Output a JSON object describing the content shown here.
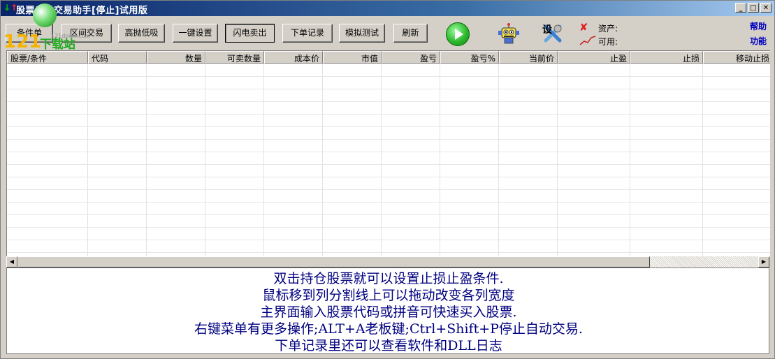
{
  "window": {
    "title": "股票自动交易助手[停止]试用版",
    "title_arrows": {
      "up": "↑",
      "down": "↓"
    },
    "controls": {
      "minimize": "_",
      "maximize": "□",
      "close": "✕"
    }
  },
  "logo": {
    "number": "121",
    "text": "下载站",
    "url": "121down.com"
  },
  "toolbar": {
    "buttons": [
      "条件单",
      "区间交易",
      "高抛低吸",
      "一键设置",
      "闪电卖出",
      "下单记录",
      "模拟测试",
      "刷新"
    ],
    "pressed_button": "闪电卖出",
    "settings_label": "设",
    "asset_label": "资产:",
    "available_label": "可用:",
    "help_link": "帮助",
    "function_link": "功能",
    "icons": [
      "play-icon",
      "robot-icon",
      "settings-icon",
      "status-x-icon",
      "trend-icon"
    ]
  },
  "table": {
    "columns": [
      "股票/条件",
      "代码",
      "数量",
      "可卖数量",
      "成本价",
      "市值",
      "盈亏",
      "盈亏%",
      "当前价",
      "止盈",
      "止损",
      "移动止损"
    ],
    "rows": []
  },
  "info": {
    "lines": [
      "双击持仓股票就可以设置止损止盈条件.",
      "鼠标移到列分割线上可以拖动改变各列宽度",
      "主界面输入股票代码或拼音可快速买入股票.",
      "右键菜单有更多操作;ALT+A老板键;Ctrl+Shift+P停止自动交易.",
      "下单记录里还可以查看软件和DLL日志"
    ]
  },
  "colors": {
    "accent": "#0a246a",
    "info_text": "#000080",
    "link": "#0000c0",
    "play": "#2eb82e"
  }
}
